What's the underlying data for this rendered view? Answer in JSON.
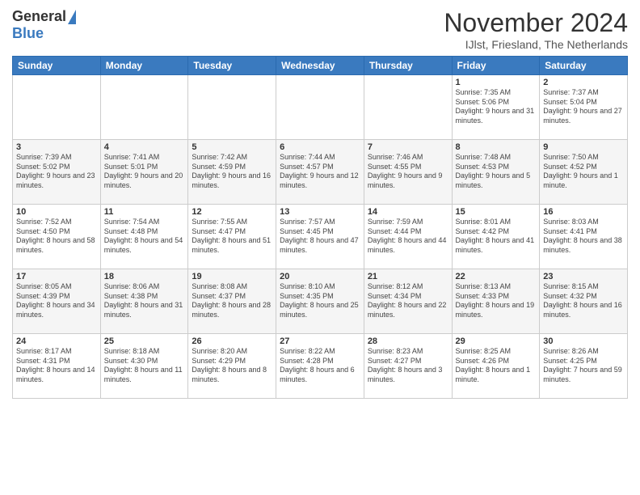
{
  "logo": {
    "general": "General",
    "blue": "Blue"
  },
  "header": {
    "title": "November 2024",
    "location": "IJlst, Friesland, The Netherlands"
  },
  "days_of_week": [
    "Sunday",
    "Monday",
    "Tuesday",
    "Wednesday",
    "Thursday",
    "Friday",
    "Saturday"
  ],
  "weeks": [
    [
      {
        "day": "",
        "info": ""
      },
      {
        "day": "",
        "info": ""
      },
      {
        "day": "",
        "info": ""
      },
      {
        "day": "",
        "info": ""
      },
      {
        "day": "",
        "info": ""
      },
      {
        "day": "1",
        "info": "Sunrise: 7:35 AM\nSunset: 5:06 PM\nDaylight: 9 hours and 31 minutes."
      },
      {
        "day": "2",
        "info": "Sunrise: 7:37 AM\nSunset: 5:04 PM\nDaylight: 9 hours and 27 minutes."
      }
    ],
    [
      {
        "day": "3",
        "info": "Sunrise: 7:39 AM\nSunset: 5:02 PM\nDaylight: 9 hours and 23 minutes."
      },
      {
        "day": "4",
        "info": "Sunrise: 7:41 AM\nSunset: 5:01 PM\nDaylight: 9 hours and 20 minutes."
      },
      {
        "day": "5",
        "info": "Sunrise: 7:42 AM\nSunset: 4:59 PM\nDaylight: 9 hours and 16 minutes."
      },
      {
        "day": "6",
        "info": "Sunrise: 7:44 AM\nSunset: 4:57 PM\nDaylight: 9 hours and 12 minutes."
      },
      {
        "day": "7",
        "info": "Sunrise: 7:46 AM\nSunset: 4:55 PM\nDaylight: 9 hours and 9 minutes."
      },
      {
        "day": "8",
        "info": "Sunrise: 7:48 AM\nSunset: 4:53 PM\nDaylight: 9 hours and 5 minutes."
      },
      {
        "day": "9",
        "info": "Sunrise: 7:50 AM\nSunset: 4:52 PM\nDaylight: 9 hours and 1 minute."
      }
    ],
    [
      {
        "day": "10",
        "info": "Sunrise: 7:52 AM\nSunset: 4:50 PM\nDaylight: 8 hours and 58 minutes."
      },
      {
        "day": "11",
        "info": "Sunrise: 7:54 AM\nSunset: 4:48 PM\nDaylight: 8 hours and 54 minutes."
      },
      {
        "day": "12",
        "info": "Sunrise: 7:55 AM\nSunset: 4:47 PM\nDaylight: 8 hours and 51 minutes."
      },
      {
        "day": "13",
        "info": "Sunrise: 7:57 AM\nSunset: 4:45 PM\nDaylight: 8 hours and 47 minutes."
      },
      {
        "day": "14",
        "info": "Sunrise: 7:59 AM\nSunset: 4:44 PM\nDaylight: 8 hours and 44 minutes."
      },
      {
        "day": "15",
        "info": "Sunrise: 8:01 AM\nSunset: 4:42 PM\nDaylight: 8 hours and 41 minutes."
      },
      {
        "day": "16",
        "info": "Sunrise: 8:03 AM\nSunset: 4:41 PM\nDaylight: 8 hours and 38 minutes."
      }
    ],
    [
      {
        "day": "17",
        "info": "Sunrise: 8:05 AM\nSunset: 4:39 PM\nDaylight: 8 hours and 34 minutes."
      },
      {
        "day": "18",
        "info": "Sunrise: 8:06 AM\nSunset: 4:38 PM\nDaylight: 8 hours and 31 minutes."
      },
      {
        "day": "19",
        "info": "Sunrise: 8:08 AM\nSunset: 4:37 PM\nDaylight: 8 hours and 28 minutes."
      },
      {
        "day": "20",
        "info": "Sunrise: 8:10 AM\nSunset: 4:35 PM\nDaylight: 8 hours and 25 minutes."
      },
      {
        "day": "21",
        "info": "Sunrise: 8:12 AM\nSunset: 4:34 PM\nDaylight: 8 hours and 22 minutes."
      },
      {
        "day": "22",
        "info": "Sunrise: 8:13 AM\nSunset: 4:33 PM\nDaylight: 8 hours and 19 minutes."
      },
      {
        "day": "23",
        "info": "Sunrise: 8:15 AM\nSunset: 4:32 PM\nDaylight: 8 hours and 16 minutes."
      }
    ],
    [
      {
        "day": "24",
        "info": "Sunrise: 8:17 AM\nSunset: 4:31 PM\nDaylight: 8 hours and 14 minutes."
      },
      {
        "day": "25",
        "info": "Sunrise: 8:18 AM\nSunset: 4:30 PM\nDaylight: 8 hours and 11 minutes."
      },
      {
        "day": "26",
        "info": "Sunrise: 8:20 AM\nSunset: 4:29 PM\nDaylight: 8 hours and 8 minutes."
      },
      {
        "day": "27",
        "info": "Sunrise: 8:22 AM\nSunset: 4:28 PM\nDaylight: 8 hours and 6 minutes."
      },
      {
        "day": "28",
        "info": "Sunrise: 8:23 AM\nSunset: 4:27 PM\nDaylight: 8 hours and 3 minutes."
      },
      {
        "day": "29",
        "info": "Sunrise: 8:25 AM\nSunset: 4:26 PM\nDaylight: 8 hours and 1 minute."
      },
      {
        "day": "30",
        "info": "Sunrise: 8:26 AM\nSunset: 4:25 PM\nDaylight: 7 hours and 59 minutes."
      }
    ]
  ]
}
